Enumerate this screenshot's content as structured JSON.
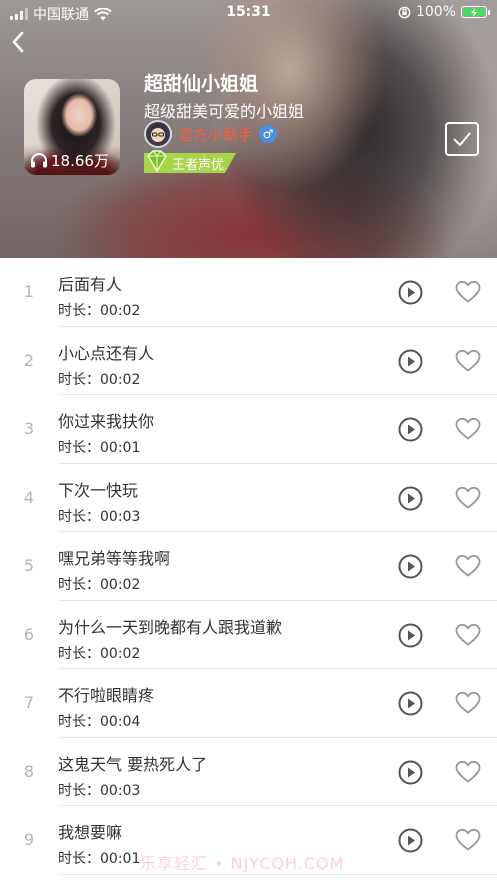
{
  "status_bar": {
    "carrier": "中国联通",
    "time": "15:31",
    "battery": "100%"
  },
  "album": {
    "title": "超甜仙小姐姐",
    "subtitle": "超级甜美可爱的小姐姐",
    "play_count": "18.66万",
    "author": "官方小助手",
    "gender_symbol": "♂",
    "badge": "王者声优"
  },
  "tracks": [
    {
      "index": "1",
      "name": "后面有人",
      "duration": "时长：00:02"
    },
    {
      "index": "2",
      "name": "小心点还有人",
      "duration": "时长：00:02"
    },
    {
      "index": "3",
      "name": "你过来我扶你",
      "duration": "时长：00:01"
    },
    {
      "index": "4",
      "name": "下次一快玩",
      "duration": "时长：00:03"
    },
    {
      "index": "5",
      "name": "嘿兄弟等等我啊",
      "duration": "时长：00:02"
    },
    {
      "index": "6",
      "name": "为什么一天到晚都有人跟我道歉",
      "duration": "时长：00:02"
    },
    {
      "index": "7",
      "name": "不行啦眼睛疼",
      "duration": "时长：00:04"
    },
    {
      "index": "8",
      "name": "这鬼天气  要热死人了",
      "duration": "时长：00:03"
    },
    {
      "index": "9",
      "name": "我想要嘛",
      "duration": "时长：00:01"
    }
  ],
  "watermark": "乐享轻汇 • NJYCQH.COM",
  "colors": {
    "author": "#ff5a3c",
    "gender_badge": "#4a90e2",
    "rank_badge": "#a8d44a",
    "icon_gray": "#555555",
    "index_gray": "#b5b5b5"
  }
}
